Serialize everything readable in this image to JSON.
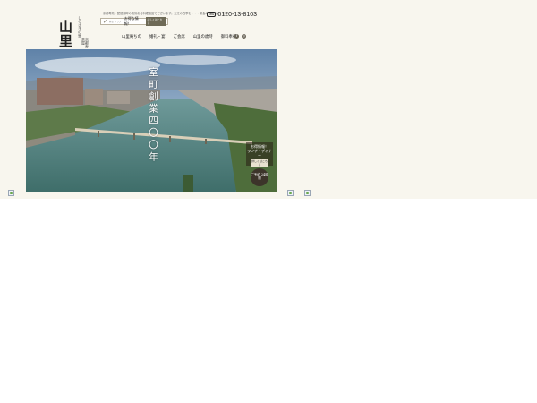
{
  "logo": {
    "brand": "山里",
    "small_a": "しらさぎの里",
    "small_b": "京都寿茶屋"
  },
  "header": {
    "tagline": "京都寿苑・琵琶湖畔の風情ある料理旅館でございます。近江の四季を・・・宴会のお知らせ・お祝い事",
    "promo_check": "✓",
    "promo_kind": "料金 プラン",
    "promo_text": "お得な情報！",
    "promo_more": "詳しくはこちら",
    "phone_icon": "TEL",
    "phone_number": "0120-13-8103"
  },
  "nav": [
    "山里庵ちの",
    "婚礼・宴",
    "ご会席",
    "山里の歳時",
    "御料奉祀"
  ],
  "social_icons": [
    "facebook-icon",
    "instagram-icon"
  ],
  "social_glyphs": [
    "f",
    "◎"
  ],
  "hero": {
    "vertical_title": "室町創業四〇〇年",
    "side_badge_text": "お得情報！",
    "side_badge_sub": "ランチ・ディナー",
    "side_badge_button": "詳しくはこちら",
    "round_badge_text": "ご予約 24時間"
  }
}
